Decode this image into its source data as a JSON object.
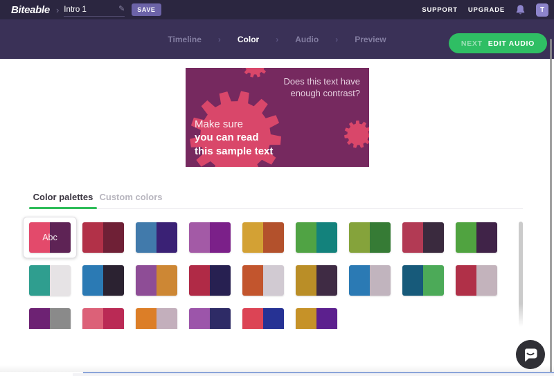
{
  "topbar": {
    "logo": "Biteable",
    "breadcrumb_separator": "›",
    "project_name": "Intro 1",
    "save_label": "SAVE",
    "support_label": "SUPPORT",
    "upgrade_label": "UPGRADE",
    "avatar_initial": "T"
  },
  "steps": {
    "separator": "›",
    "items": [
      {
        "label": "Timeline",
        "active": false
      },
      {
        "label": "Color",
        "active": true
      },
      {
        "label": "Audio",
        "active": false
      },
      {
        "label": "Preview",
        "active": false
      }
    ],
    "next_prefix": "NEXT",
    "next_label": "EDIT AUDIO"
  },
  "preview": {
    "question_line1": "Does this text have",
    "question_line2": "enough contrast?",
    "sample_line1": "Make sure",
    "sample_line2": "you can read",
    "sample_line3": "this sample text",
    "bg_color": "#76295f",
    "gear_color": "#d9476a"
  },
  "tabs": {
    "active": "Color palettes",
    "inactive": "Custom colors",
    "underline_color": "#2ebd59"
  },
  "palettes": {
    "rows": [
      [
        {
          "left": "#e34a6b",
          "right": "#5e2355",
          "selected": true,
          "label": "Abc"
        },
        {
          "left": "#b23148",
          "right": "#6f2036"
        },
        {
          "left": "#417aab",
          "right": "#3a2175"
        },
        {
          "left": "#a35aa6",
          "right": "#7b2089"
        },
        {
          "left": "#d3a134",
          "right": "#b3512c"
        },
        {
          "left": "#50a344",
          "right": "#13827c"
        },
        {
          "left": "#85a33b",
          "right": "#367b35"
        },
        {
          "left": "#b23a54",
          "right": "#3a2a3e"
        },
        {
          "left": "#50a340",
          "right": "#402348"
        }
      ],
      [
        {
          "left": "#2f9e8f",
          "right": "#e6e3e5"
        },
        {
          "left": "#2b7ab4",
          "right": "#2b2231"
        },
        {
          "left": "#8e4d96",
          "right": "#cd8734"
        },
        {
          "left": "#b02a46",
          "right": "#272051"
        },
        {
          "left": "#c2552d",
          "right": "#d1cad2"
        },
        {
          "left": "#ba8e27",
          "right": "#3f2b44"
        },
        {
          "left": "#2b7ab4",
          "right": "#c1b4be"
        },
        {
          "left": "#175a7a",
          "right": "#4caa58"
        },
        {
          "left": "#b03048",
          "right": "#c3b3bc"
        }
      ],
      [
        {
          "left": "#6d2273",
          "right": "#8a8a8a"
        },
        {
          "left": "#dc6178",
          "right": "#ba2a55"
        },
        {
          "left": "#dc7e27",
          "right": "#c3afbc"
        },
        {
          "left": "#9c55aa",
          "right": "#2e2b66"
        },
        {
          "left": "#dc4455",
          "right": "#263294"
        },
        {
          "left": "#c69228",
          "right": "#5c208e"
        }
      ]
    ]
  },
  "colors": {
    "topbar_bg": "#2b2640",
    "stepsbar_bg": "#3a3157",
    "accent_green": "#2fbe64",
    "save_button_bg": "#6c63a8",
    "bell_color": "#8d84cb",
    "bottom_line": "#8ba5d9"
  }
}
